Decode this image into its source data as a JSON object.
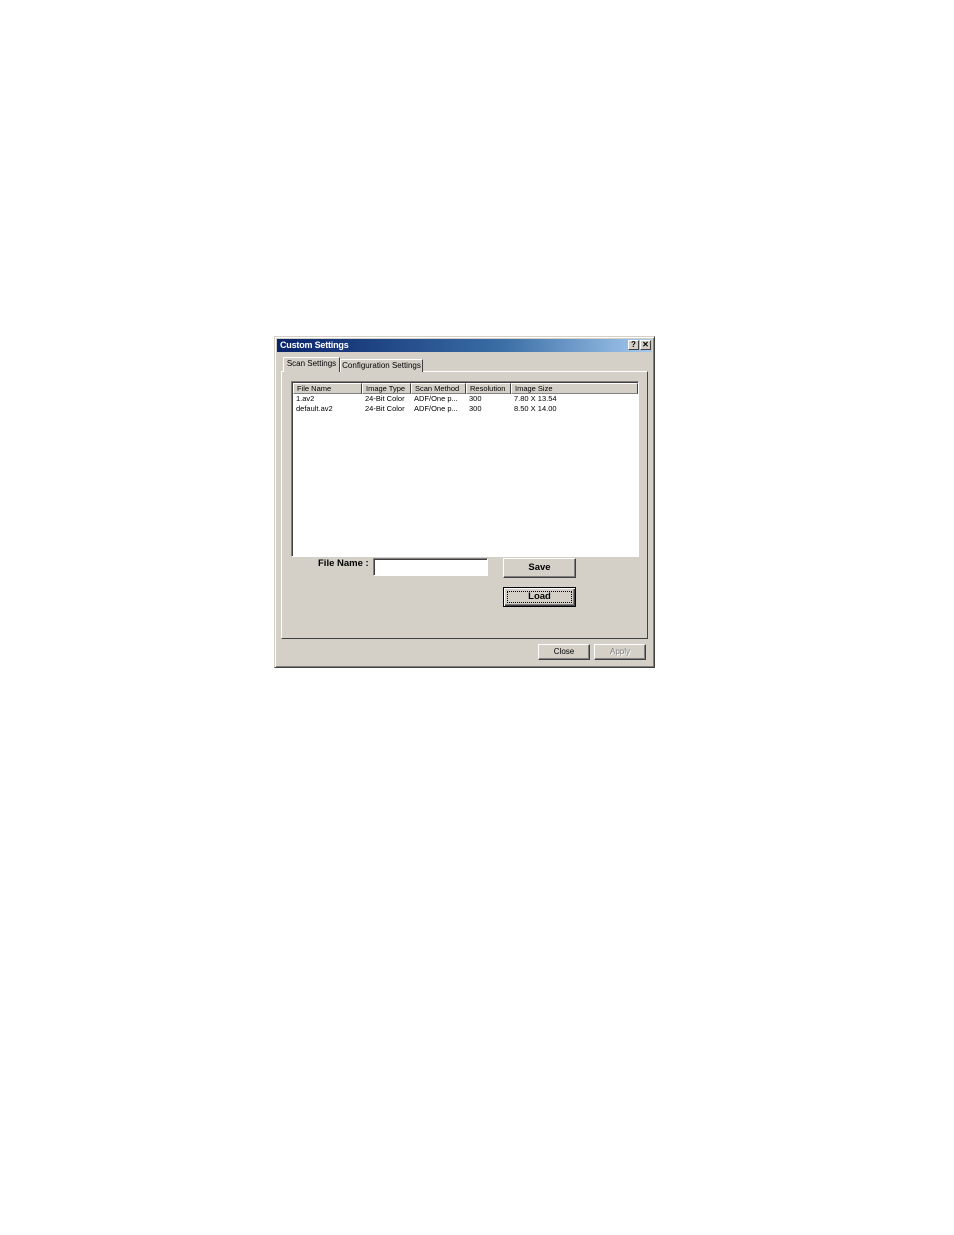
{
  "dialog": {
    "title": "Custom Settings",
    "help_button": "?",
    "close_glyph": "✕"
  },
  "tabs": [
    {
      "label": "Scan Settings",
      "active": true
    },
    {
      "label": "Configuration Settings",
      "active": false
    }
  ],
  "list": {
    "columns": [
      "File Name",
      "Image Type",
      "Scan Method",
      "Resolution",
      "Image Size"
    ],
    "rows": [
      [
        "1.av2",
        "24-Bit Color",
        "ADF/One p...",
        "300",
        "7.80 X 13.54"
      ],
      [
        "default.av2",
        "24-Bit Color",
        "ADF/One p...",
        "300",
        "8.50 X 14.00"
      ]
    ]
  },
  "form": {
    "file_name_label": "File Name :",
    "file_name_value": ""
  },
  "buttons": {
    "save": "Save",
    "load": "Load",
    "close": "Close",
    "apply": "Apply"
  }
}
